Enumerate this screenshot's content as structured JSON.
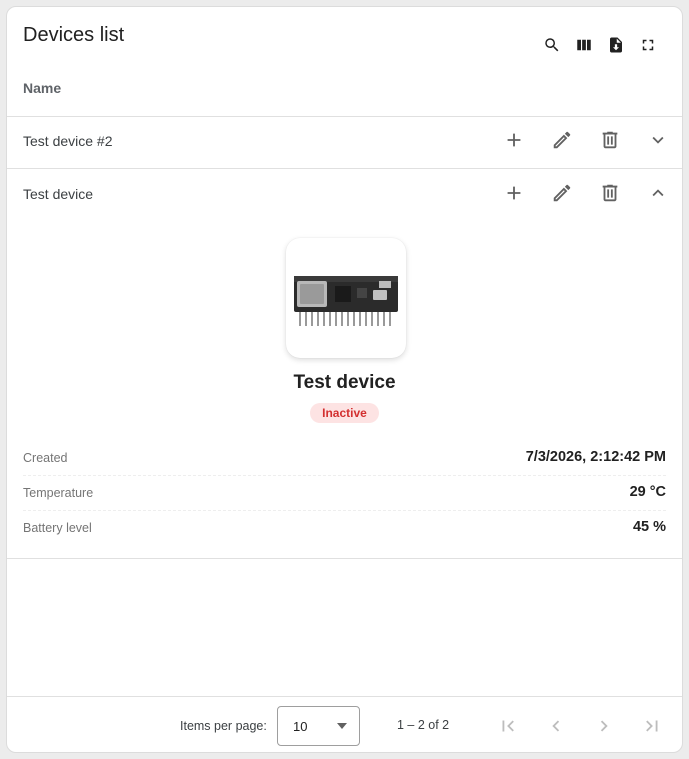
{
  "panel": {
    "title": "Devices list"
  },
  "toolbar": {
    "icons": [
      "search-icon",
      "columns-icon",
      "export-file-icon",
      "fullscreen-icon"
    ]
  },
  "table": {
    "column_name": "Name",
    "rows": [
      {
        "name": "Test device #2",
        "expanded": false
      },
      {
        "name": "Test device",
        "expanded": true
      }
    ]
  },
  "details": {
    "title": "Test device",
    "status": "Inactive",
    "status_color": "#d32f2f",
    "properties": [
      {
        "label": "Created",
        "value": "7/3/2026, 2:12:42 PM"
      },
      {
        "label": "Temperature",
        "value": "29 °C"
      },
      {
        "label": "Battery level",
        "value": "45 %"
      }
    ]
  },
  "pagination": {
    "items_per_page_label": "Items per page:",
    "items_per_page_value": "10",
    "range_label": "1 – 2 of 2"
  },
  "colors": {
    "icon": "#616161",
    "icon_disabled": "#bdbdbd",
    "divider": "#e0e0e0"
  }
}
